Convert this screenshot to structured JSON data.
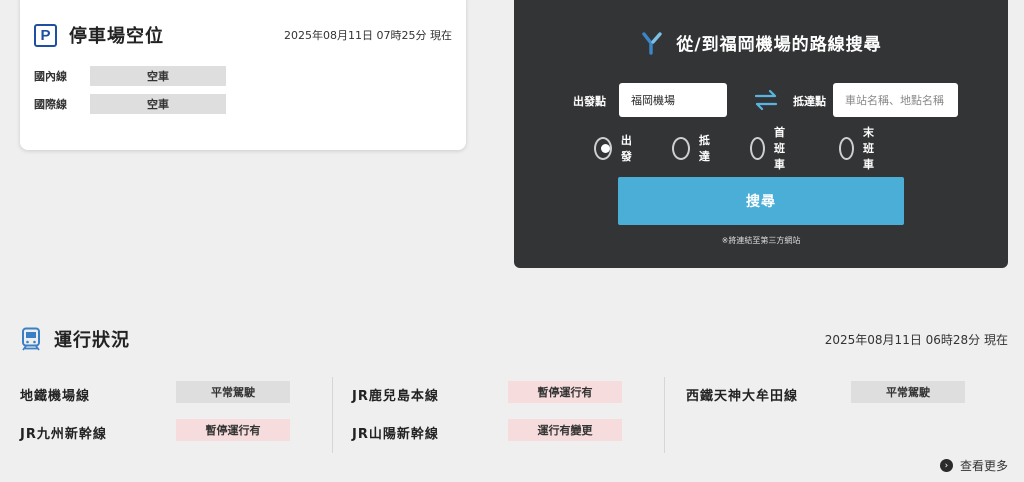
{
  "parking": {
    "icon_letter": "P",
    "title": "停車場空位",
    "timestamp": "2025年08月11日 07時25分 現在",
    "rows": [
      {
        "label": "國內線",
        "status": "空車"
      },
      {
        "label": "國際線",
        "status": "空車"
      }
    ]
  },
  "route_search": {
    "title": "從/到福岡機場的路線搜尋",
    "from_label": "出發點",
    "from_value": "福岡機場",
    "to_label": "抵達點",
    "to_placeholder": "車站名稱、地點名稱",
    "options": [
      {
        "label": "出發",
        "checked": true
      },
      {
        "label": "抵達",
        "checked": false
      },
      {
        "label": "首班車",
        "checked": false
      },
      {
        "label": "末班車",
        "checked": false
      }
    ],
    "search_label": "搜尋",
    "note": "※將連結至第三方網站",
    "accent_color": "#4aaed7"
  },
  "operations": {
    "title": "運行狀況",
    "timestamp": "2025年08月11日 06時28分 現在",
    "lines": [
      {
        "name": "地鐵機場線",
        "status": "平常駕駛",
        "level": "normal"
      },
      {
        "name": "JR九州新幹線",
        "status": "暫停運行有",
        "level": "alert"
      },
      {
        "name": "JR鹿兒島本線",
        "status": "暫停運行有",
        "level": "alert"
      },
      {
        "name": "JR山陽新幹線",
        "status": "運行有變更",
        "level": "alert"
      },
      {
        "name": "西鐵天神大牟田線",
        "status": "平常駕駛",
        "level": "normal"
      }
    ],
    "more_label": "查看更多"
  }
}
